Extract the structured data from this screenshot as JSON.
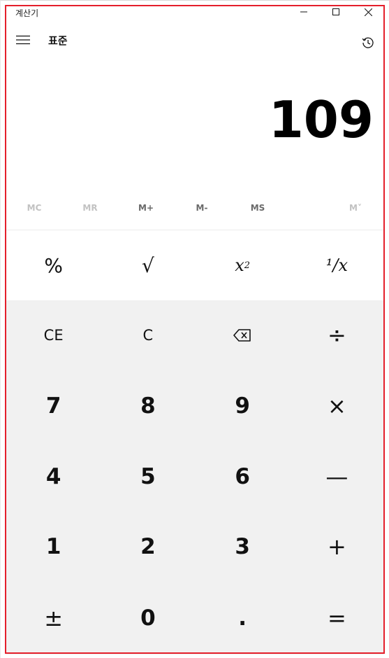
{
  "window": {
    "title": "계산기"
  },
  "header": {
    "mode": "표준"
  },
  "display": {
    "value": "109"
  },
  "memory": [
    {
      "label": "MC",
      "enabled": false
    },
    {
      "label": "MR",
      "enabled": false
    },
    {
      "label": "M+",
      "enabled": true
    },
    {
      "label": "M-",
      "enabled": true
    },
    {
      "label": "MS",
      "enabled": true
    },
    {
      "label": "M˅",
      "enabled": false
    }
  ],
  "keys": {
    "percent": "%",
    "sqrt": "√",
    "square_base": "x",
    "square_exp": "2",
    "reciprocal": "¹/x",
    "ce": "CE",
    "c": "C",
    "divide": "÷",
    "seven": "7",
    "eight": "8",
    "nine": "9",
    "multiply": "×",
    "four": "4",
    "five": "5",
    "six": "6",
    "minus": "—",
    "one": "1",
    "two": "2",
    "three": "3",
    "plus": "+",
    "negate": "±",
    "zero": "0",
    "decimal": ".",
    "equals": "="
  },
  "icons": {
    "minimize": "minimize-icon",
    "maximize": "maximize-icon",
    "close": "close-icon",
    "menu": "hamburger-icon",
    "history": "history-icon",
    "backspace": "backspace-icon"
  },
  "colors": {
    "accent_frame": "#e41f2b",
    "keypad_background": "#f1f1f1",
    "memory_disabled": "#c2c2c2",
    "memory_enabled": "#6a6a6a"
  }
}
